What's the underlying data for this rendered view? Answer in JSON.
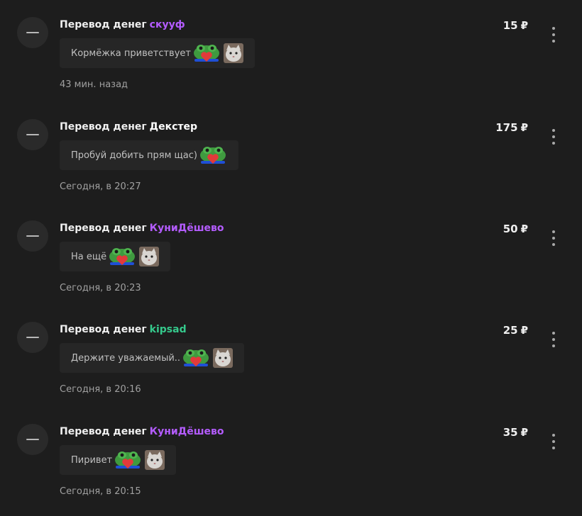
{
  "colors": {
    "background": "#1d1d1d",
    "purple_user": "#b45cff",
    "white_user": "#ffffff",
    "green_user": "#35c98c"
  },
  "icons": {
    "avatar": "minus-icon",
    "menu": "more-vertical-icon",
    "emote_frog": "frog-heart-emote",
    "emote_cat": "cat-emote"
  },
  "transfers": [
    {
      "label": "Перевод денег",
      "user": "скууф",
      "user_color": "#b45cff",
      "amount": "15",
      "currency": "₽",
      "message": "Кормёжка приветствует",
      "emotes": [
        "frog",
        "cat"
      ],
      "time": "43 мин. назад"
    },
    {
      "label": "Перевод денег",
      "user": "Декстер",
      "user_color": "#ffffff",
      "amount": "175",
      "currency": "₽",
      "message": "Пробуй добить прям щас)",
      "emotes": [
        "frog"
      ],
      "time": "Сегодня, в 20:27"
    },
    {
      "label": "Перевод денег",
      "user": "КуниДёшево",
      "user_color": "#b45cff",
      "amount": "50",
      "currency": "₽",
      "message": "На ещё",
      "emotes": [
        "frog",
        "cat"
      ],
      "time": "Сегодня, в 20:23"
    },
    {
      "label": "Перевод денег",
      "user": "kipsad",
      "user_color": "#35c98c",
      "amount": "25",
      "currency": "₽",
      "message": "Держите уважаемый..",
      "emotes": [
        "frog",
        "cat"
      ],
      "time": "Сегодня, в 20:16"
    },
    {
      "label": "Перевод денег",
      "user": "КуниДёшево",
      "user_color": "#b45cff",
      "amount": "35",
      "currency": "₽",
      "message": "Пиривет",
      "emotes": [
        "frog",
        "cat"
      ],
      "time": "Сегодня, в 20:15"
    }
  ]
}
